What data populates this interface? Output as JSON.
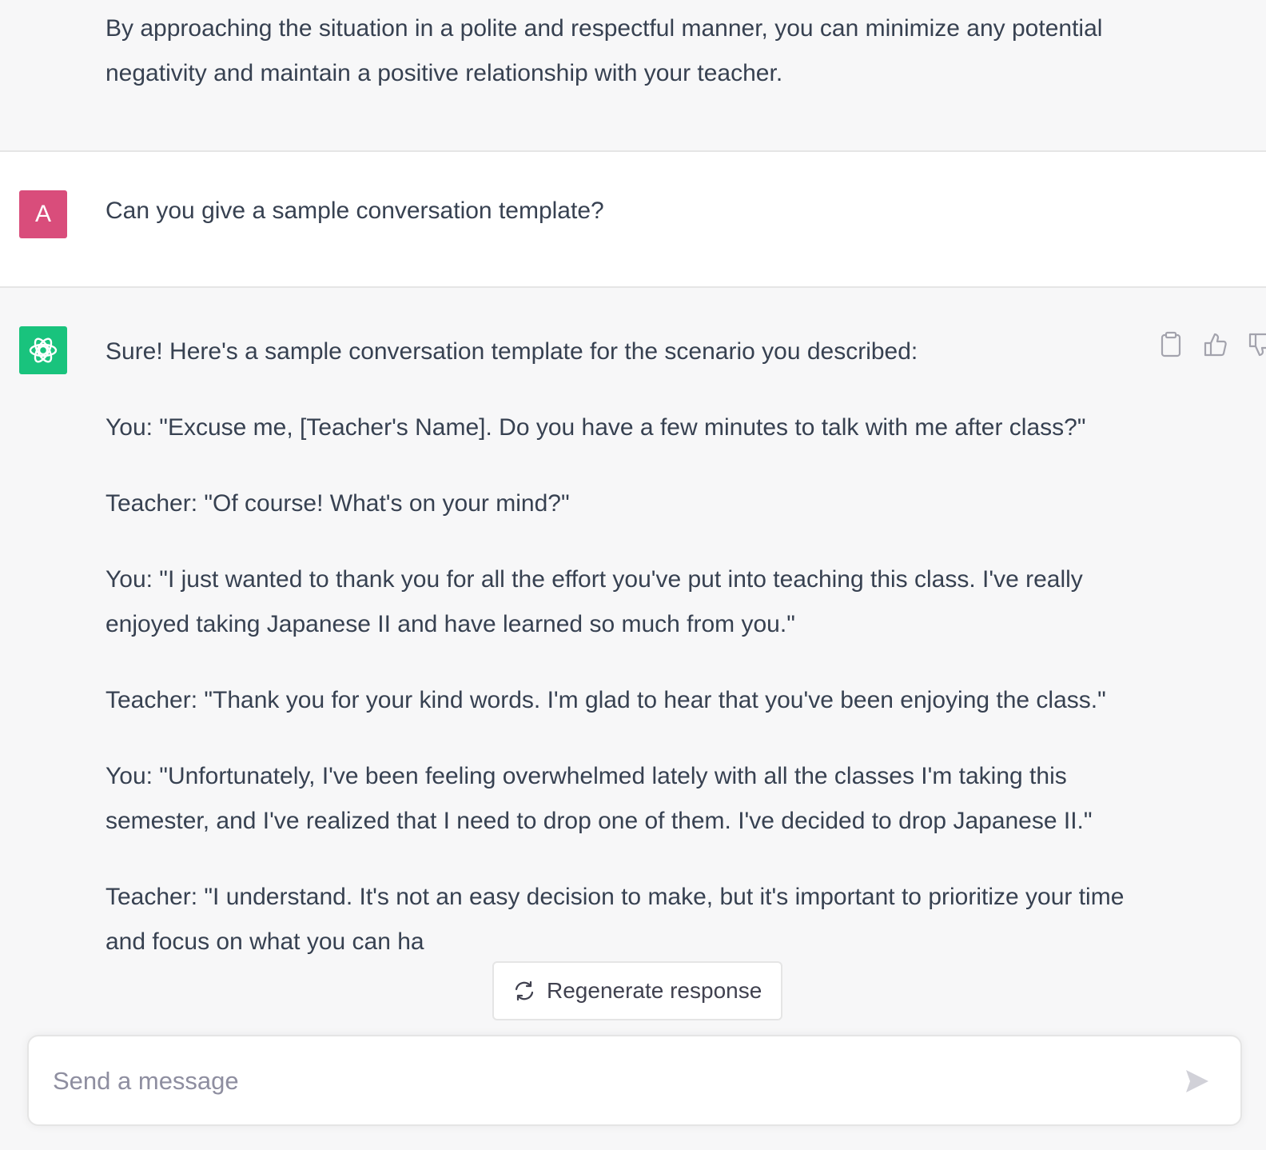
{
  "previous_message": {
    "text": "By approaching the situation in a polite and respectful manner, you can minimize any potential negativity and maintain a positive relationship with your teacher."
  },
  "user_message": {
    "avatar_letter": "A",
    "text": "Can you give a sample conversation template?"
  },
  "assistant_message": {
    "paragraphs": [
      "Sure! Here's a sample conversation template for the scenario you described:",
      "You: \"Excuse me, [Teacher's Name]. Do you have a few minutes to talk with me after class?\"",
      "Teacher: \"Of course! What's on your mind?\"",
      "You: \"I just wanted to thank you for all the effort you've put into teaching this class. I've really enjoyed taking Japanese II and have learned so much from you.\"",
      "Teacher: \"Thank you for your kind words. I'm glad to hear that you've been enjoying the class.\"",
      "You: \"Unfortunately, I've been feeling overwhelmed lately with all the classes I'm taking this semester, and I've realized that I need to drop one of them. I've decided to drop Japanese II.\"",
      "Teacher: \"I understand. It's not an easy decision to make, but it's important to prioritize your time and focus on what you can ha"
    ],
    "actions": [
      {
        "name": "copy-button",
        "icon": "clipboard-icon"
      },
      {
        "name": "thumbs-up-button",
        "icon": "thumbs-up-icon"
      },
      {
        "name": "thumbs-down-button",
        "icon": "thumbs-down-icon"
      }
    ]
  },
  "regenerate": {
    "label": "Regenerate response",
    "icon": "refresh-icon"
  },
  "composer": {
    "placeholder": "Send a message",
    "value": "",
    "send_icon": "send-icon"
  },
  "colors": {
    "user_avatar": "#d94d7b",
    "bot_avatar": "#19c37d",
    "text": "#374151",
    "assistant_bg": "#f7f7f8",
    "user_bg": "#ffffff"
  }
}
